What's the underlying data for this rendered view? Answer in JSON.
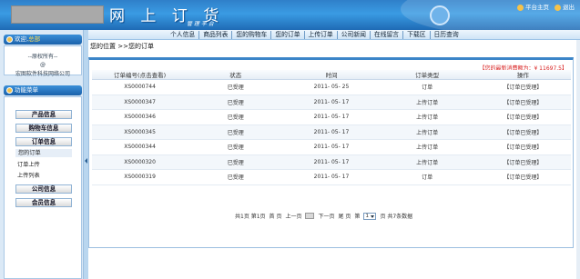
{
  "header": {
    "title": "网 上 订 货",
    "subtitle": "管 理 平 台",
    "links": [
      "平台主页",
      "退出"
    ]
  },
  "nav": {
    "items": [
      "个人信息",
      "商品列表",
      "您的购物车",
      "您的订单",
      "上传订单",
      "公司新闻",
      "在线留言",
      "下载区",
      "日历查询"
    ]
  },
  "sidebar": {
    "welcome_label": "欢迎,",
    "welcome_name": "总部",
    "user_line1": "--原权所有--",
    "user_line2": "@",
    "user_line3": "宏图软件科技网络公司",
    "function_title": "功能菜单",
    "menu": [
      {
        "label": "产品信息"
      },
      {
        "label": "购物车信息"
      },
      {
        "label": "订单信息"
      },
      {
        "label": "公司信息"
      },
      {
        "label": "会员信息"
      }
    ],
    "sub_items": [
      "您的订单",
      "订单上传",
      "上传列表"
    ]
  },
  "main": {
    "breadcrumb": "您的位置 >>您的订单",
    "balance": "【您的最新消费额为：¥ 11697.5】",
    "table": {
      "headers": [
        "订单编号(点击查看)",
        "状态",
        "时间",
        "订单类型",
        "操作"
      ],
      "rows": [
        [
          "XS0000744",
          "已受理",
          "2011- 05- 25",
          "订单",
          "【订单已受理】"
        ],
        [
          "XS0000347",
          "已受理",
          "2011- 05- 17",
          "上传订单",
          "【订单已受理】"
        ],
        [
          "XS0000346",
          "已受理",
          "2011- 05- 17",
          "上传订单",
          "【订单已受理】"
        ],
        [
          "XS0000345",
          "已受理",
          "2011- 05- 17",
          "上传订单",
          "【订单已受理】"
        ],
        [
          "XS0000344",
          "已受理",
          "2011- 05- 17",
          "上传订单",
          "【订单已受理】"
        ],
        [
          "XS0000320",
          "已受理",
          "2011- 05- 17",
          "上传订单",
          "【订单已受理】"
        ],
        [
          "XS0000319",
          "已受理",
          "2011- 05- 17",
          "订单",
          "【订单已受理】"
        ]
      ]
    },
    "pager": {
      "summary": "共1页 第1页",
      "first": "首 页",
      "prev": "上一页",
      "next": "下一页",
      "last": "尾 页",
      "goto": "第",
      "page_value": "1",
      "after": "页 共7条数据"
    }
  },
  "colors": {
    "header_blue": "#2f7fc9",
    "balance_red": "#d81f1f"
  }
}
